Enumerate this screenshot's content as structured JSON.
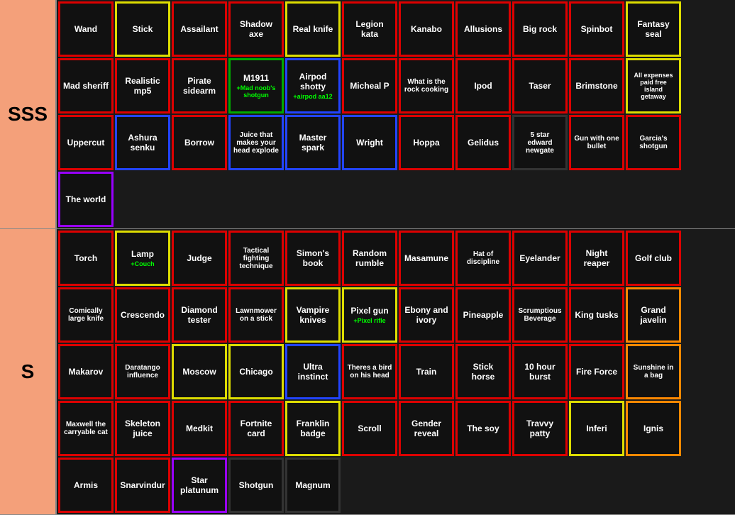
{
  "tiers": [
    {
      "label": "SSS",
      "rows": [
        [
          {
            "text": "Wand",
            "border": "red"
          },
          {
            "text": "Stick",
            "border": "yellow"
          },
          {
            "text": "Assailant",
            "border": "red"
          },
          {
            "text": "Shadow axe",
            "border": "red"
          },
          {
            "text": "Real knife",
            "border": "yellow"
          },
          {
            "text": "Legion kata",
            "border": "red"
          },
          {
            "text": "Kanabo",
            "border": "red"
          },
          {
            "text": "Allusions",
            "border": "red"
          },
          {
            "text": "Big rock",
            "border": "red"
          },
          {
            "text": "Spinbot",
            "border": "red"
          },
          {
            "text": "Fantasy seal",
            "border": "yellow"
          }
        ],
        [
          {
            "text": "Mad sheriff",
            "border": "red"
          },
          {
            "text": "Realistic mp5",
            "border": "red"
          },
          {
            "text": "Pirate sidearm",
            "border": "red"
          },
          {
            "text": "M1911",
            "sub": "+Mad noob's shotgun",
            "border": "green"
          },
          {
            "text": "Airpod shotty",
            "sub": "+airpod aa12",
            "border": "blue"
          },
          {
            "text": "Micheal P",
            "border": "red"
          },
          {
            "text": "What is the rock cooking",
            "border": "red"
          },
          {
            "text": "Ipod",
            "border": "red"
          },
          {
            "text": "Taser",
            "border": "red"
          },
          {
            "text": "Brimstone",
            "border": "red"
          },
          {
            "text": "All expenses paid free island getaway",
            "border": "yellow",
            "small": true
          }
        ],
        [
          {
            "text": "Uppercut",
            "border": "red"
          },
          {
            "text": "Ashura senku",
            "border": "blue"
          },
          {
            "text": "Borrow",
            "border": "red"
          },
          {
            "text": "Juice that makes your head explode",
            "border": "blue"
          },
          {
            "text": "Master spark",
            "border": "blue"
          },
          {
            "text": "Wright",
            "border": "blue"
          },
          {
            "text": "Hoppa",
            "border": "red"
          },
          {
            "text": "Gelidus",
            "border": "red"
          },
          {
            "text": "5 star edward newgate",
            "border": "dark"
          },
          {
            "text": "Gun with one bullet",
            "border": "red"
          },
          {
            "text": "Garcia's shotgun",
            "border": "red"
          }
        ],
        [
          {
            "text": "The world",
            "border": "purple"
          }
        ]
      ]
    },
    {
      "label": "S",
      "rows": [
        [
          {
            "text": "Torch",
            "border": "red"
          },
          {
            "text": "Lamp",
            "sub": "+Couch",
            "border": "yellow"
          },
          {
            "text": "Judge",
            "border": "red"
          },
          {
            "text": "Tactical fighting technique",
            "border": "red"
          },
          {
            "text": "Simon's book",
            "border": "red"
          },
          {
            "text": "Random rumble",
            "border": "red"
          },
          {
            "text": "Masamune",
            "border": "red"
          },
          {
            "text": "Hat of discipline",
            "border": "red"
          },
          {
            "text": "Eyelander",
            "border": "red"
          },
          {
            "text": "Night reaper",
            "border": "red"
          },
          {
            "text": "Golf club",
            "border": "red"
          }
        ],
        [
          {
            "text": "Comically large knife",
            "border": "red"
          },
          {
            "text": "Crescendo",
            "border": "red"
          },
          {
            "text": "Diamond tester",
            "border": "red"
          },
          {
            "text": "Lawnmower on a stick",
            "border": "red"
          },
          {
            "text": "Vampire knives",
            "border": "yellow"
          },
          {
            "text": "Pixel gun",
            "sub": "+Pixel rifle",
            "border": "yellow"
          },
          {
            "text": "Ebony and ivory",
            "border": "red"
          },
          {
            "text": "Pineapple",
            "border": "red"
          },
          {
            "text": "Scrumptious Beverage",
            "border": "red"
          },
          {
            "text": "King tusks",
            "border": "red"
          },
          {
            "text": "Grand javelin",
            "border": "orange"
          }
        ],
        [
          {
            "text": "Makarov",
            "border": "red"
          },
          {
            "text": "Daratango influence",
            "border": "red"
          },
          {
            "text": "Moscow",
            "border": "yellow"
          },
          {
            "text": "Chicago",
            "border": "yellow"
          },
          {
            "text": "Ultra instinct",
            "border": "blue"
          },
          {
            "text": "Theres a bird on his head",
            "border": "red"
          },
          {
            "text": "Train",
            "border": "red"
          },
          {
            "text": "Stick horse",
            "border": "red"
          },
          {
            "text": "10 hour burst",
            "border": "red"
          },
          {
            "text": "Fire Force",
            "border": "red"
          },
          {
            "text": "Sunshine in a bag",
            "border": "orange"
          }
        ],
        [
          {
            "text": "Maxwell the carryable cat",
            "border": "red"
          },
          {
            "text": "Skeleton juice",
            "border": "red"
          },
          {
            "text": "Medkit",
            "border": "red"
          },
          {
            "text": "Fortnite card",
            "border": "red"
          },
          {
            "text": "Franklin badge",
            "border": "yellow"
          },
          {
            "text": "Scroll",
            "border": "red"
          },
          {
            "text": "Gender reveal",
            "border": "red"
          },
          {
            "text": "The soy",
            "border": "red"
          },
          {
            "text": "Travvy patty",
            "border": "red"
          },
          {
            "text": "Inferi",
            "border": "yellow"
          },
          {
            "text": "Ignis",
            "border": "orange"
          }
        ],
        [
          {
            "text": "Armis",
            "border": "red"
          },
          {
            "text": "Snarvindur",
            "border": "red"
          },
          {
            "text": "Star platunum",
            "border": "purple"
          },
          {
            "text": "Shotgun",
            "border": "dark"
          },
          {
            "text": "Magnum",
            "border": "dark"
          }
        ]
      ]
    }
  ]
}
